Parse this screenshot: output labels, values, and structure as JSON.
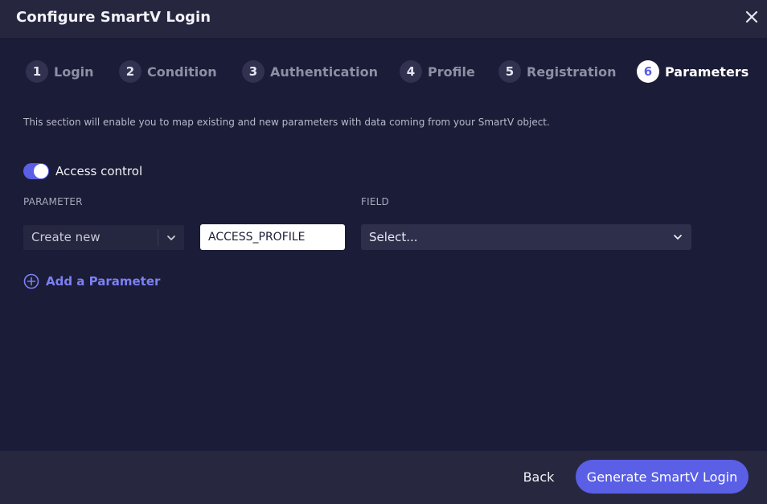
{
  "modal": {
    "title": "Configure SmartV Login"
  },
  "steps": [
    {
      "number": "1",
      "label": "Login",
      "active": false
    },
    {
      "number": "2",
      "label": "Condition",
      "active": false
    },
    {
      "number": "3",
      "label": "Authentication",
      "active": false
    },
    {
      "number": "4",
      "label": "Profile",
      "active": false
    },
    {
      "number": "5",
      "label": "Registration",
      "active": false
    },
    {
      "number": "6",
      "label": "Parameters",
      "active": true
    }
  ],
  "content": {
    "description": "This section will enable you to map existing and new parameters with data coming from your SmartV object.",
    "access_control": {
      "label": "Access control",
      "enabled": true
    },
    "columns": {
      "parameter": "PARAMETER",
      "field": "FIELD"
    },
    "row": {
      "mode_value": "Create new",
      "parameter_name": "ACCESS_PROFILE",
      "field_value": "Select..."
    },
    "add_parameter_label": "Add a Parameter"
  },
  "footer": {
    "back_label": "Back",
    "primary_label": "Generate SmartV Login"
  },
  "colors": {
    "accent": "#5a5fe6",
    "background": "#1b1c37",
    "header": "#26273f",
    "link": "#7b80f3"
  },
  "icons": {
    "close": "close-icon",
    "chevron": "chevron-down-icon",
    "add": "plus-circle-icon"
  }
}
